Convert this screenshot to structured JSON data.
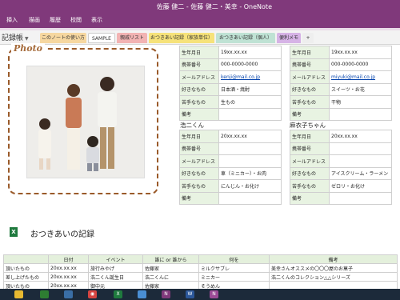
{
  "window": {
    "title": "佐藤 健二 - 佐藤 健二・美幸 - OneNote"
  },
  "menu": [
    "挿入",
    "描画",
    "履歴",
    "校閲",
    "表示"
  ],
  "notebook": {
    "name": "記録帳"
  },
  "sections": [
    {
      "label": "このノートの使い方",
      "color": "#f6d7a0"
    },
    {
      "label": "SAMPLE",
      "color": "#ffffff"
    },
    {
      "label": "親戚リスト",
      "color": "#f2b3b3"
    },
    {
      "label": "おつきあい記録（家族単位）",
      "color": "#f6e27a"
    },
    {
      "label": "おつきあい記録（個人）",
      "color": "#bfe2d4"
    },
    {
      "label": "便利メモ",
      "color": "#d6b3e6"
    },
    {
      "label": "+",
      "color": "#eeeeee"
    }
  ],
  "photo": {
    "label": "Photo"
  },
  "profiles": [
    {
      "name": "",
      "rows": [
        {
          "key": "生年月日",
          "value": "19xx.xx.xx"
        },
        {
          "key": "携帯番号",
          "value": "000-0000-0000"
        },
        {
          "key": "メールアドレス",
          "value": "kenji@mail.co.jp"
        },
        {
          "key": "好きなもの",
          "value": "日本酒・焼酎"
        },
        {
          "key": "苦手なもの",
          "value": "生もの"
        },
        {
          "key": "備考",
          "value": ""
        }
      ]
    },
    {
      "name": "",
      "rows": [
        {
          "key": "生年月日",
          "value": "19xx.xx.xx"
        },
        {
          "key": "携帯番号",
          "value": "000-0000-0000"
        },
        {
          "key": "メールアドレス",
          "value": "miyuki@mail.co.jp"
        },
        {
          "key": "好きなもの",
          "value": "スイーツ・お花"
        },
        {
          "key": "苦手なもの",
          "value": "干物"
        },
        {
          "key": "備考",
          "value": ""
        }
      ]
    },
    {
      "name": "浩二くん",
      "rows": [
        {
          "key": "生年月日",
          "value": "20xx.xx.xx"
        },
        {
          "key": "携帯番号",
          "value": ""
        },
        {
          "key": "メールアドレス",
          "value": ""
        },
        {
          "key": "好きなもの",
          "value": "車（ミニカー）・お肉"
        },
        {
          "key": "苦手なもの",
          "value": "にんじん・お化け"
        },
        {
          "key": "備考",
          "value": ""
        }
      ]
    },
    {
      "name": "麻衣子ちゃん",
      "rows": [
        {
          "key": "生年月日",
          "value": "20xx.xx.xx"
        },
        {
          "key": "携帯番号",
          "value": ""
        },
        {
          "key": "メールアドレス",
          "value": ""
        },
        {
          "key": "好きなもの",
          "value": "アイスクリーム・ラーメン"
        },
        {
          "key": "苦手なもの",
          "value": "ゼロリ・お化け"
        },
        {
          "key": "備考",
          "value": ""
        }
      ]
    }
  ],
  "log": {
    "title": "おつきあいの記録",
    "headers": [
      "",
      "日付",
      "イベント",
      "誰に or 誰から",
      "何を",
      "備考"
    ],
    "rows": [
      [
        "頂いたもの",
        "20xx.xx.xx",
        "旅行みやげ",
        "佐藤家",
        "ミルクサブレ",
        "美幸さんオススメの〇〇〇屋のお菓子"
      ],
      [
        "差し上げたもの",
        "20xx.xx.xx",
        "浩二くん誕生日",
        "浩二くんに",
        "ミニカー",
        "浩二くんのコレクション△△シリーズ"
      ],
      [
        "頂いたもの",
        "20xx.xx.xx",
        "御中元",
        "佐藤家",
        "そうめん",
        ""
      ]
    ]
  },
  "taskbar": [
    {
      "name": "file-explorer-icon",
      "color": "#e8b931",
      "glyph": ""
    },
    {
      "name": "store-icon",
      "color": "#2e7d32",
      "glyph": ""
    },
    {
      "name": "photos-icon",
      "color": "#3a6ea5",
      "glyph": ""
    },
    {
      "name": "chrome-icon",
      "color": "#d64541",
      "glyph": "◉"
    },
    {
      "name": "excel-icon",
      "color": "#1f7a3e",
      "glyph": "X"
    },
    {
      "name": "app-icon",
      "color": "#4a8fd4",
      "glyph": ""
    },
    {
      "name": "onenote-icon",
      "color": "#80397b",
      "glyph": "N"
    },
    {
      "name": "word-icon",
      "color": "#2b579a",
      "glyph": "W"
    },
    {
      "name": "onenote-active-icon",
      "color": "#9b4b96",
      "glyph": "N"
    }
  ]
}
